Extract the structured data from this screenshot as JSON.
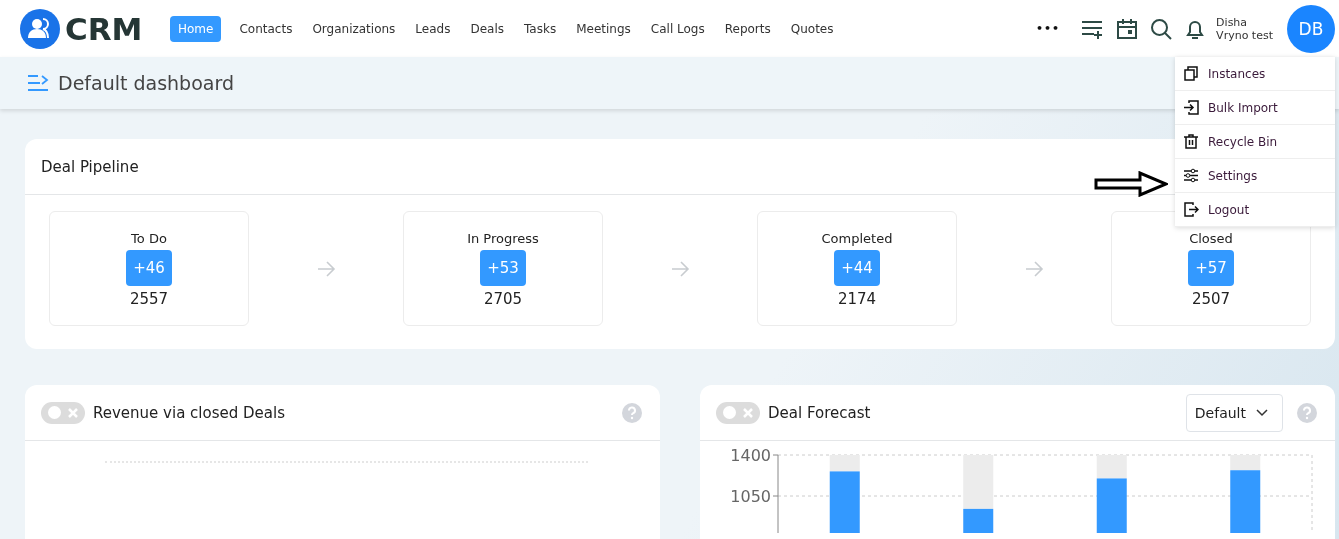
{
  "app": {
    "logo_text": "CRM"
  },
  "nav": [
    {
      "label": "Home",
      "selected": true
    },
    {
      "label": "Contacts",
      "selected": false
    },
    {
      "label": "Organizations",
      "selected": false
    },
    {
      "label": "Leads",
      "selected": false
    },
    {
      "label": "Deals",
      "selected": false
    },
    {
      "label": "Tasks",
      "selected": false
    },
    {
      "label": "Meetings",
      "selected": false
    },
    {
      "label": "Call Logs",
      "selected": false
    },
    {
      "label": "Reports",
      "selected": false
    },
    {
      "label": "Quotes",
      "selected": false
    }
  ],
  "more": "•••",
  "user": {
    "first_line": "Disha",
    "second_line": "Vryno test",
    "initials": "DB"
  },
  "user_menu": [
    {
      "kind": "instances",
      "label": "Instances"
    },
    {
      "kind": "import",
      "label": "Bulk Import"
    },
    {
      "kind": "bin",
      "label": "Recycle Bin"
    },
    {
      "kind": "settings",
      "label": "Settings"
    },
    {
      "kind": "logout",
      "label": "Logout"
    }
  ],
  "page_title": "Default dashboard",
  "pipeline": {
    "title": "Deal Pipeline",
    "stages": [
      {
        "name": "To Do",
        "badge": "+46",
        "total": "2557"
      },
      {
        "name": "In Progress",
        "badge": "+53",
        "total": "2705"
      },
      {
        "name": "Completed",
        "badge": "+44",
        "total": "2174"
      },
      {
        "name": "Closed",
        "badge": "+57",
        "total": "2507"
      }
    ]
  },
  "widgets": [
    {
      "title": "Revenue via closed Deals",
      "on": false
    },
    {
      "title": "Deal Forecast",
      "on": false,
      "filter": "Default",
      "chart_data": {
        "type": "bar",
        "yticks": [
          1050,
          1400
        ],
        "ylim": [
          750,
          1400
        ],
        "series": [
          {
            "color": "#3399ff",
            "values": [
              1260,
              940,
              1200,
              1270
            ]
          }
        ]
      }
    }
  ]
}
